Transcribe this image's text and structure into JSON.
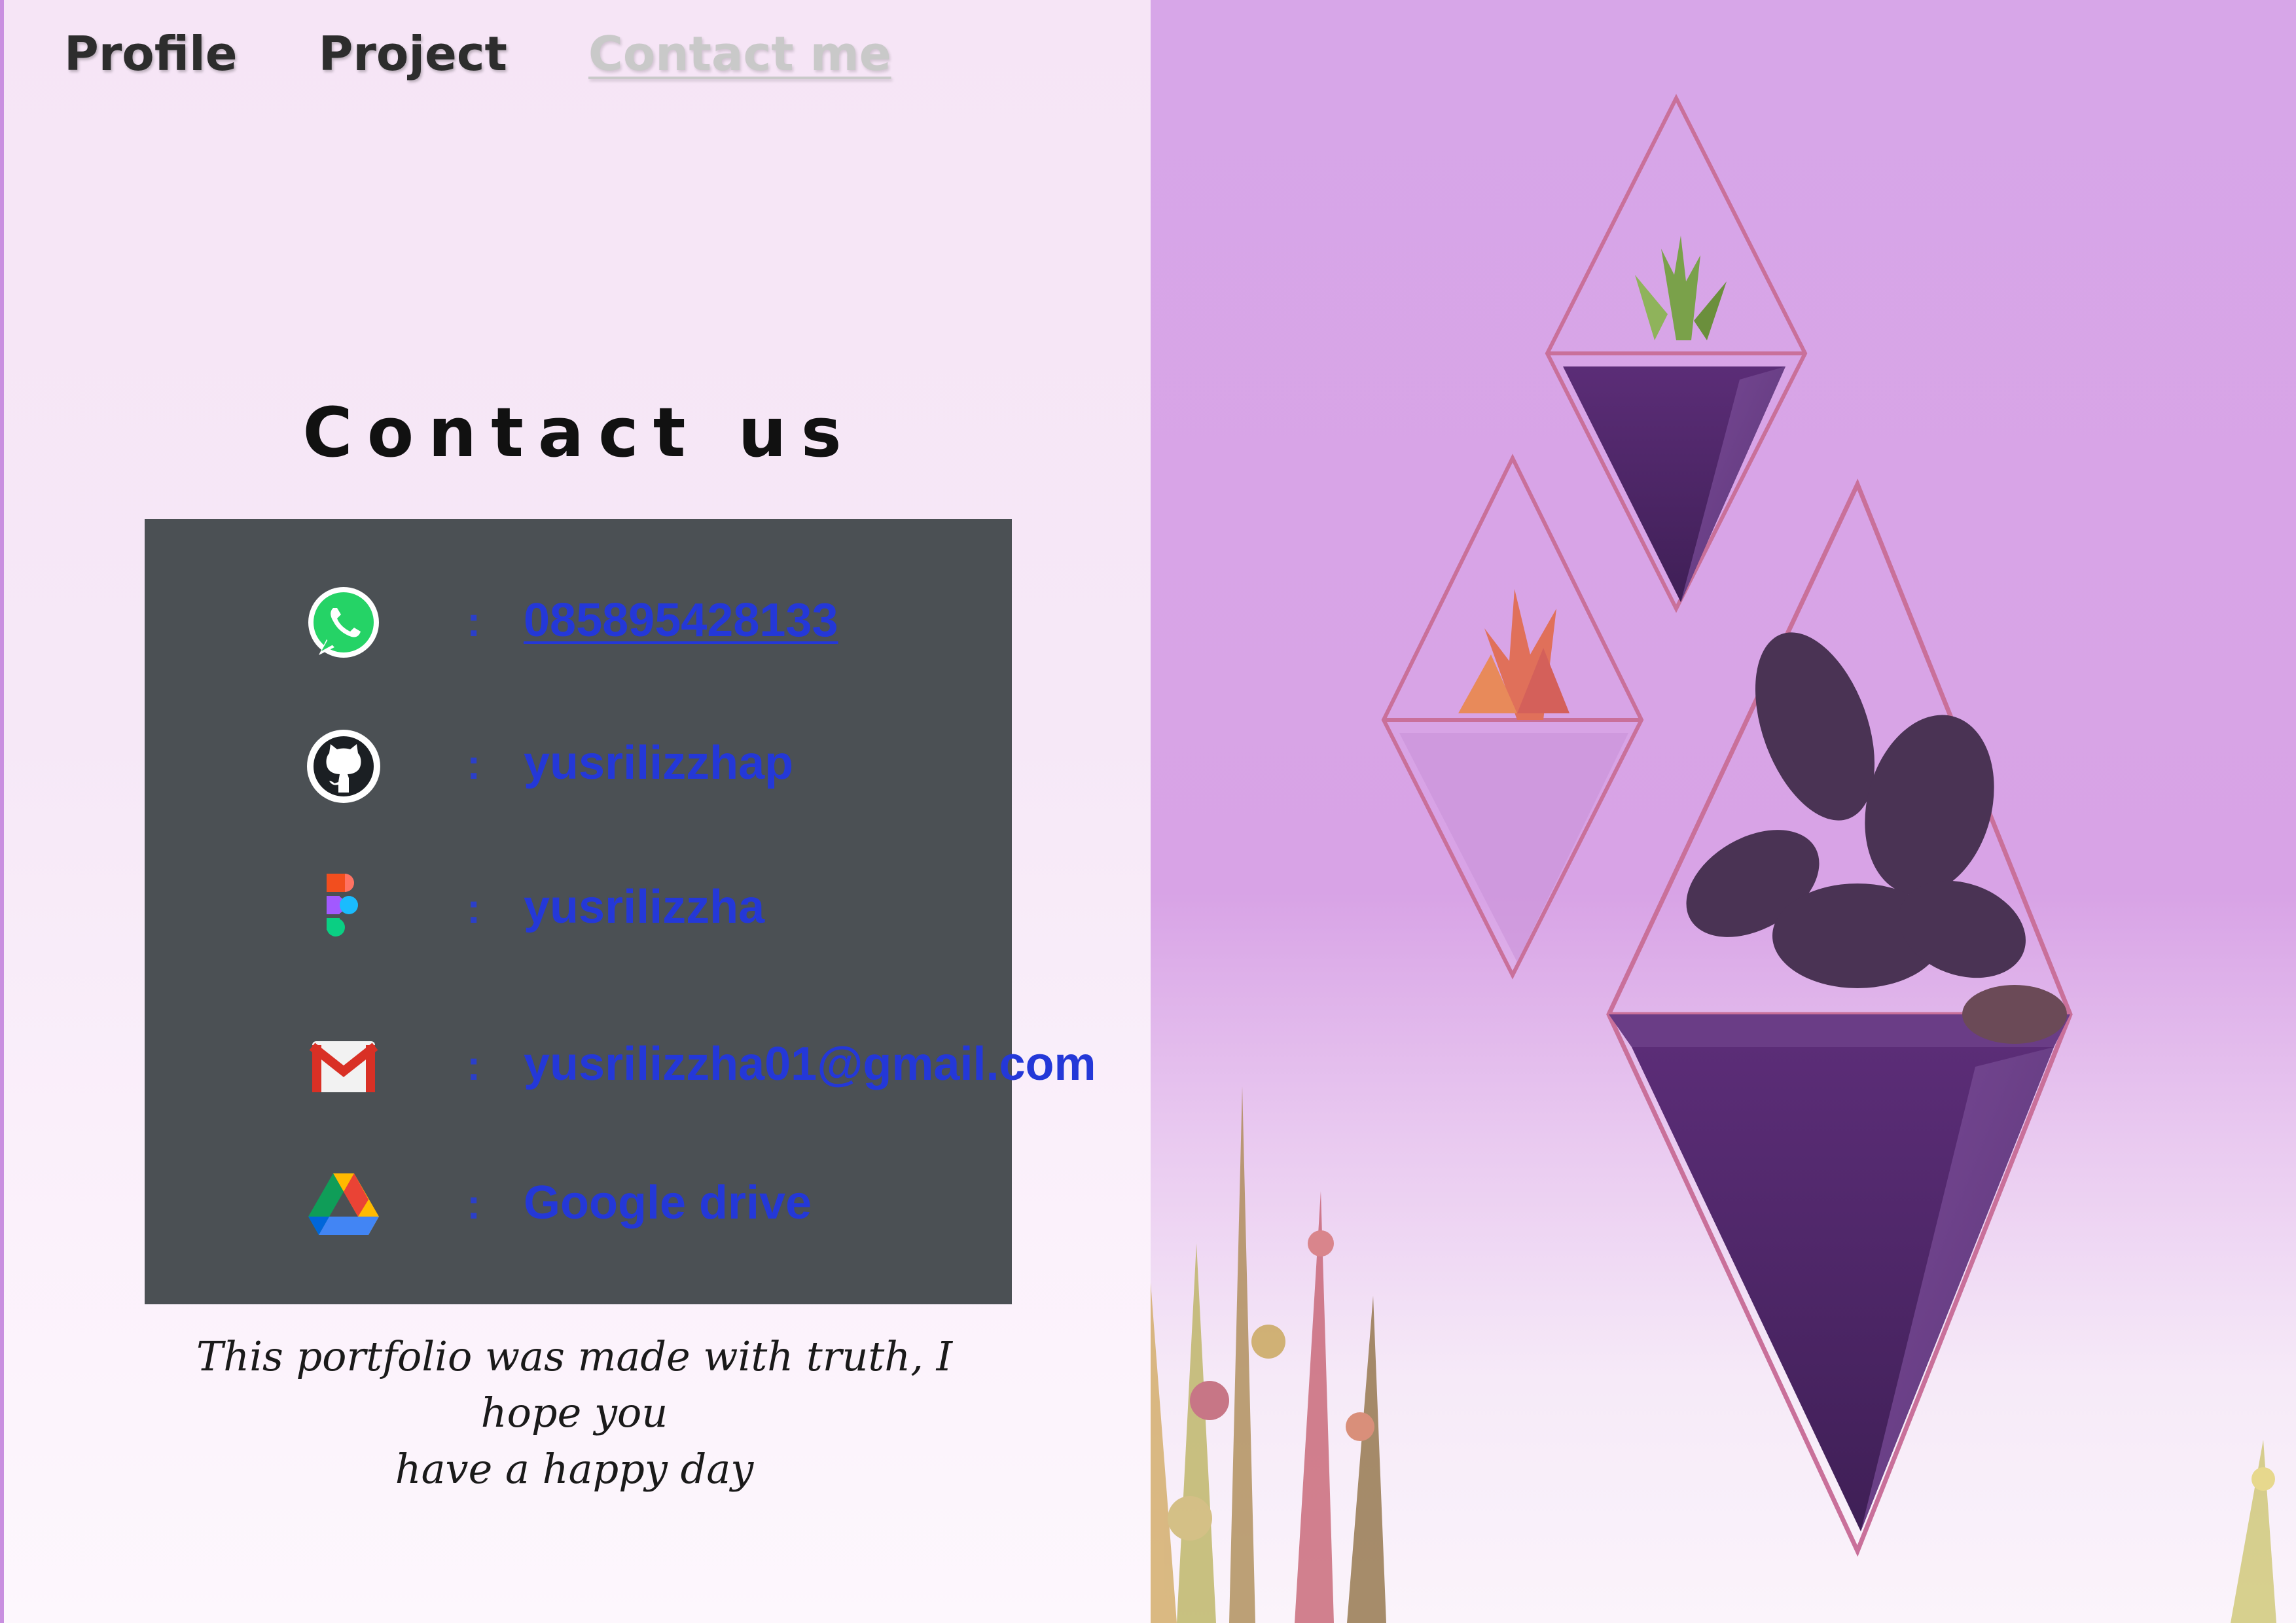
{
  "nav": {
    "items": [
      {
        "label": "Profile"
      },
      {
        "label": "Project"
      },
      {
        "label": "Contact me"
      }
    ]
  },
  "contact": {
    "title": "Contact us",
    "separator": ":",
    "entries": [
      {
        "icon": "whatsapp-icon",
        "value": "085895428133"
      },
      {
        "icon": "github-icon",
        "value": "yusrilizzhap"
      },
      {
        "icon": "figma-icon",
        "value": "yusrilizzha"
      },
      {
        "icon": "gmail-icon",
        "value": "yusrilizzha01@gmail.com"
      },
      {
        "icon": "google-drive-icon",
        "value": "Google drive"
      }
    ]
  },
  "footer": {
    "line1": "This portfolio was made with truth, I hope you",
    "line2": "have a happy day"
  },
  "colors": {
    "link": "#2438d8",
    "card": "#4b5054",
    "accent": "#c98fe0"
  }
}
